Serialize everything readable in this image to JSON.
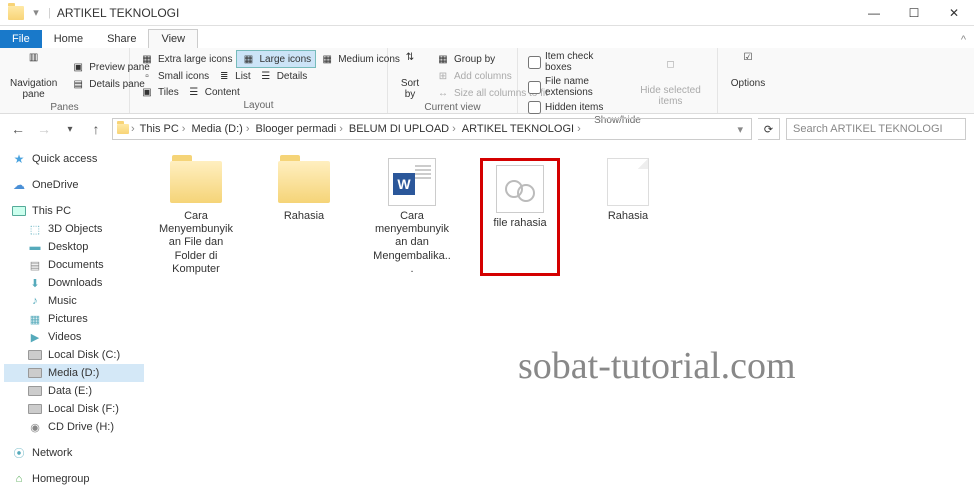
{
  "title": "ARTIKEL TEKNOLOGI",
  "tabs": {
    "file": "File",
    "home": "Home",
    "share": "Share",
    "view": "View"
  },
  "ribbon": {
    "panes": {
      "group": "Panes",
      "nav": "Navigation pane",
      "preview": "Preview pane",
      "details": "Details pane"
    },
    "layout": {
      "group": "Layout",
      "xlarge": "Extra large icons",
      "large": "Large icons",
      "medium": "Medium icons",
      "small": "Small icons",
      "list": "List",
      "details": "Details",
      "tiles": "Tiles",
      "content": "Content"
    },
    "current": {
      "group": "Current view",
      "sort": "Sort by",
      "group_by": "Group by",
      "add_cols": "Add columns",
      "size_fit": "Size all columns to fit"
    },
    "showhide": {
      "group": "Show/hide",
      "item_check": "Item check boxes",
      "ext": "File name extensions",
      "hidden": "Hidden items",
      "hide_sel": "Hide selected items"
    },
    "options": "Options"
  },
  "breadcrumb": [
    "This PC",
    "Media (D:)",
    "Blooger permadi",
    "BELUM DI UPLOAD",
    "ARTIKEL TEKNOLOGI"
  ],
  "search_placeholder": "Search ARTIKEL TEKNOLOGI",
  "sidebar": {
    "quick": "Quick access",
    "onedrive": "OneDrive",
    "thispc": "This PC",
    "items": [
      "3D Objects",
      "Desktop",
      "Documents",
      "Downloads",
      "Music",
      "Pictures",
      "Videos",
      "Local Disk (C:)",
      "Media (D:)",
      "Data (E:)",
      "Local Disk (F:)",
      "CD Drive (H:)"
    ],
    "network": "Network",
    "homegroup": "Homegroup"
  },
  "files": [
    {
      "name": "Cara Menyembunyikan File dan Folder di Komputer",
      "type": "folder"
    },
    {
      "name": "Rahasia",
      "type": "folder"
    },
    {
      "name": "Cara menyembunyikan dan Mengembalika...",
      "type": "word"
    },
    {
      "name": "file rahasia",
      "type": "exe",
      "highlight": true
    },
    {
      "name": "Rahasia",
      "type": "txt"
    }
  ],
  "watermark": "sobat-tutorial.com"
}
